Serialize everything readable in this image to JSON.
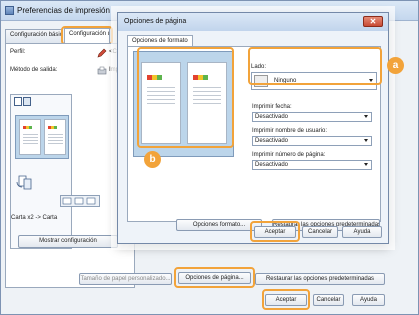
{
  "back_window": {
    "title": "Preferencias de impresión",
    "tabs": [
      "Configuración básica",
      "Configuración de"
    ],
    "perfil_label": "Perfil:",
    "perfil_value": "<C",
    "metodo_label": "Método de salida:",
    "metodo_value": "Imp",
    "preview_caption": "Carta x2 -> Carta",
    "mostrar_button": "Mostrar configuración",
    "tamano_button": "Tamaño de papel personalizado...",
    "opciones_pagina_button": "Opciones de página...",
    "restaurar_button": "Restaurar las opciones predeterminadas",
    "aceptar_button": "Aceptar",
    "cancelar_button": "Cancelar",
    "ayuda_button": "Ayuda"
  },
  "dialog": {
    "title": "Opciones de página",
    "close_symbol": "✕",
    "tab": "Opciones de formato",
    "lado_label": "Lado:",
    "lado_value": "Ninguno",
    "imprimir_fecha_label": "Imprimir fecha:",
    "imprimir_fecha_value": "Desactivado",
    "imprimir_usuario_label": "Imprimir nombre de usuario:",
    "imprimir_usuario_value": "Desactivado",
    "imprimir_pagina_label": "Imprimir número de página:",
    "imprimir_pagina_value": "Desactivado",
    "opciones_formato_button": "Opciones formato...",
    "restaurar_button": "Restaurar las opciones predeterminadas",
    "aceptar_button": "Aceptar",
    "cancelar_button": "Cancelar",
    "ayuda_button": "Ayuda"
  },
  "callouts": {
    "a": "a",
    "b": "b"
  },
  "colors": {
    "highlight": "#f2a33a",
    "preview_bg": "#bcd5ea",
    "close_red": "#c84a34"
  }
}
